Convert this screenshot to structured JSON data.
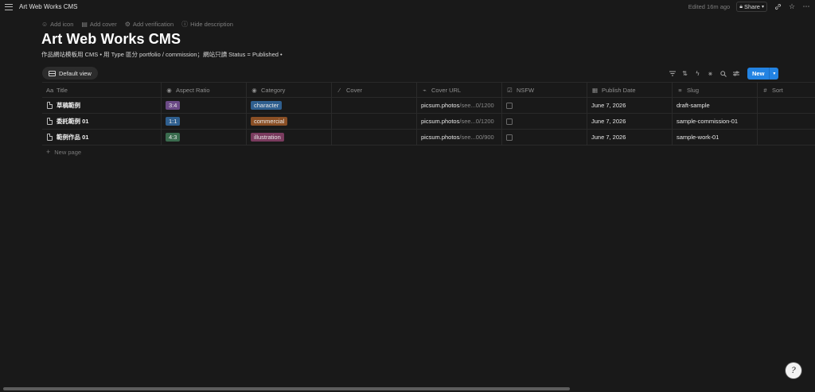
{
  "topbar": {
    "title": "Art Web Works CMS",
    "edited": "Edited 16m ago",
    "share_label": "Share"
  },
  "page_actions": {
    "add_icon": "Add icon",
    "add_cover": "Add cover",
    "add_verification": "Add verification",
    "hide_description": "Hide description"
  },
  "page": {
    "title": "Art Web Works CMS",
    "description": "作品網站模板用 CMS • 用 Type 區分 portfolio / commission；網站只讀 Status = Published •"
  },
  "view": {
    "label": "Default view"
  },
  "toolbar": {
    "new_label": "New"
  },
  "table": {
    "headers": {
      "title": "Title",
      "aspect": "Aspect Ratio",
      "category": "Category",
      "cover": "Cover",
      "url": "Cover URL",
      "nsfw": "NSFW",
      "date": "Publish Date",
      "slug": "Slug",
      "sort": "Sort"
    },
    "rows": [
      {
        "title": "草稿範例",
        "aspect": "3:4",
        "aspect_color": "#6b4a86",
        "category": "character",
        "category_color": "#2f5f8f",
        "url_main": "picsum.photos",
        "url_dim": "/see...0/1200",
        "date": "June 7, 2026",
        "slug": "draft-sample"
      },
      {
        "title": "委託範例 01",
        "aspect": "1:1",
        "aspect_color": "#2f5f8f",
        "category": "commercial",
        "category_color": "#8a4f25",
        "url_main": "picsum.photos",
        "url_dim": "/see...0/1200",
        "date": "June 7, 2026",
        "slug": "sample-commission-01"
      },
      {
        "title": "範例作品 01",
        "aspect": "4:3",
        "aspect_color": "#3a6b4e",
        "category": "illustration",
        "category_color": "#7a3b5e",
        "url_main": "picsum.photos",
        "url_dim": "/see...00/900",
        "date": "June 7, 2026",
        "slug": "sample-work-01"
      }
    ]
  },
  "new_page_label": "New page",
  "colors": {
    "accent": "#2383e2",
    "background": "#191919"
  }
}
